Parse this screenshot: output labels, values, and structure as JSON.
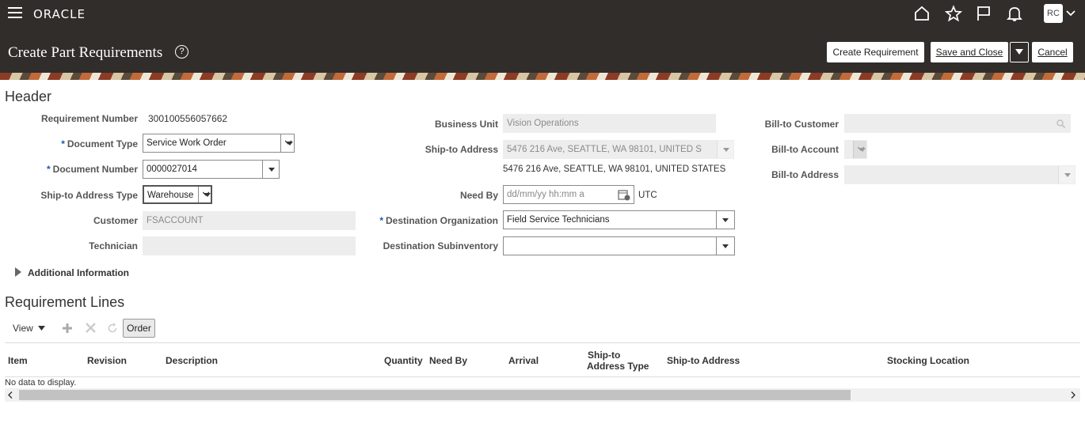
{
  "app": {
    "logo": "ORACLE",
    "user_initials": "RC",
    "page_title": "Create Part Requirements",
    "help_symbol": "?"
  },
  "actions": {
    "create_requirement": "Create Requirement",
    "save_and_close": "Save and Close",
    "cancel": "Cancel"
  },
  "header": {
    "title": "Header",
    "requirement_number": {
      "label": "Requirement Number",
      "value": "300100556057662"
    },
    "document_type": {
      "label": "Document Type",
      "value": "Service Work Order"
    },
    "document_number": {
      "label": "Document Number",
      "value": "0000027014"
    },
    "ship_to_address_type": {
      "label": "Ship-to Address Type",
      "value": "Warehouse"
    },
    "customer": {
      "label": "Customer",
      "value": "FSACCOUNT"
    },
    "technician": {
      "label": "Technician",
      "value": ""
    },
    "business_unit": {
      "label": "Business Unit",
      "value": "Vision Operations"
    },
    "ship_to_address": {
      "label": "Ship-to Address",
      "value": "5476 216 Ave, SEATTLE, WA 98101, UNITED S",
      "full": "5476 216 Ave, SEATTLE, WA 98101, UNITED STATES"
    },
    "need_by": {
      "label": "Need By",
      "placeholder": "dd/mm/yy hh:mm a",
      "timezone": "UTC"
    },
    "destination_organization": {
      "label": "Destination Organization",
      "value": "Field Service Technicians"
    },
    "destination_subinventory": {
      "label": "Destination Subinventory",
      "value": ""
    },
    "bill_to_customer": {
      "label": "Bill-to Customer",
      "value": ""
    },
    "bill_to_account": {
      "label": "Bill-to Account",
      "value": ""
    },
    "bill_to_address": {
      "label": "Bill-to Address",
      "value": ""
    },
    "additional_information": "Additional Information"
  },
  "lines": {
    "title": "Requirement Lines",
    "view_label": "View",
    "order_label": "Order",
    "columns": {
      "item": "Item",
      "revision": "Revision",
      "description": "Description",
      "quantity": "Quantity",
      "need_by": "Need By",
      "arrival": "Arrival",
      "ship_to_type_1": "Ship-to",
      "ship_to_type_2": "Address Type",
      "ship_to_address": "Ship-to Address",
      "stocking_location": "Stocking Location"
    },
    "empty_message": "No data to display."
  }
}
